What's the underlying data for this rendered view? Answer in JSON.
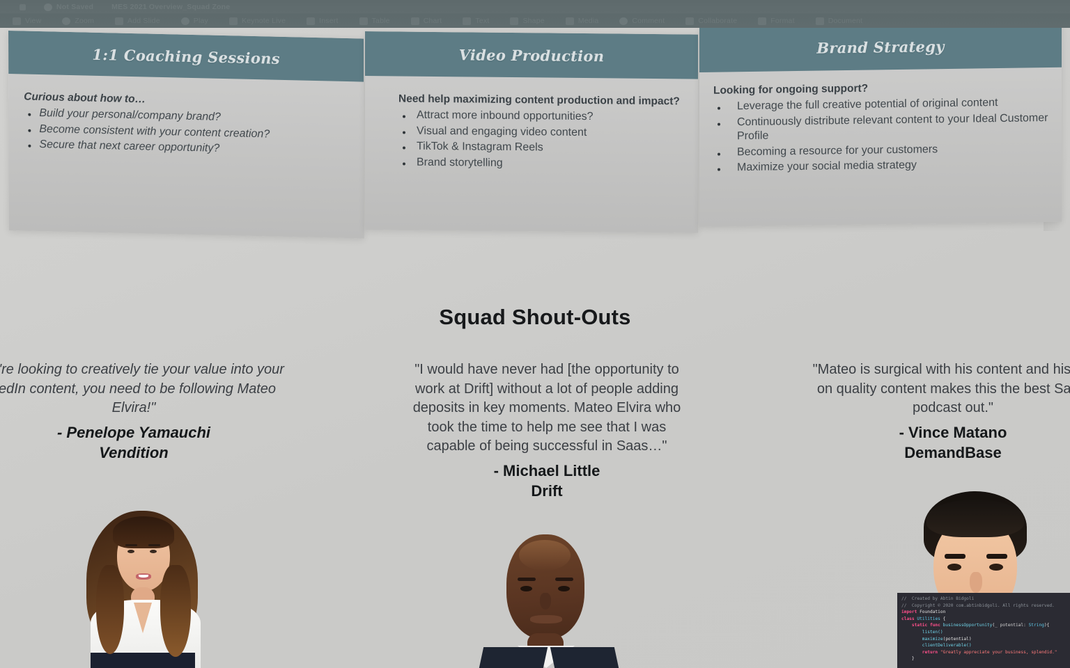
{
  "app": {
    "toolbar": {
      "row1": [
        {
          "icon": "pencil-icon",
          "label": ""
        },
        {
          "icon": "cloud-icon",
          "label": "Not Saved"
        },
        {
          "icon": "",
          "label": "MES 2021 Overview_Squad Zone"
        }
      ],
      "row2": [
        {
          "icon": "view-icon",
          "label": "View"
        },
        {
          "icon": "zoom-icon",
          "label": "Zoom"
        },
        {
          "icon": "add-slide-icon",
          "label": "Add Slide"
        },
        {
          "icon": "play-icon",
          "label": "Play"
        },
        {
          "icon": "keynote-live-icon",
          "label": "Keynote Live"
        },
        {
          "icon": "insert-icon",
          "label": "Insert"
        },
        {
          "icon": "table-icon",
          "label": "Table"
        },
        {
          "icon": "chart-icon",
          "label": "Chart"
        },
        {
          "icon": "text-icon",
          "label": "Text"
        },
        {
          "icon": "shape-icon",
          "label": "Shape"
        },
        {
          "icon": "media-icon",
          "label": "Media"
        },
        {
          "icon": "comment-icon",
          "label": "Comment"
        },
        {
          "icon": "collaborate-icon",
          "label": "Collaborate"
        },
        {
          "icon": "format-icon",
          "label": "Format"
        },
        {
          "icon": "document-icon",
          "label": "Document"
        }
      ]
    }
  },
  "cards": [
    {
      "id": "coaching",
      "title": "1:1 Coaching Sessions",
      "lead": "Curious about how to…",
      "bullets": [
        "Build your personal/company brand?",
        "Become consistent with your content creation?",
        "Secure that next career opportunity?"
      ]
    },
    {
      "id": "video",
      "title": "Video Production",
      "lead": "Need help maximizing content production and impact?",
      "bullets": [
        "Attract more inbound opportunities?",
        "Visual and engaging video content",
        "TikTok & Instagram Reels",
        "Brand storytelling"
      ]
    },
    {
      "id": "brand",
      "title": "Brand Strategy",
      "lead": "Looking for ongoing support?",
      "bullets": [
        "Leverage the full creative potential of original content",
        "Continuously distribute relevant content to your Ideal Customer Profile",
        "Becoming a resource for your customers",
        "Maximize your social media strategy"
      ]
    }
  ],
  "section": {
    "heading": "Squad Shout-Outs"
  },
  "testimonials": [
    {
      "id": "penelope",
      "quote": "ou're looking to creatively tie your value into your\nkedIn content, you need to be following Mateo\nElvira!\"",
      "author": "- Penelope Yamauchi",
      "company": "Vendition",
      "style": "italic"
    },
    {
      "id": "michael",
      "quote": "\"I would have never had [the opportunity to\nwork at Drift] without a lot of people adding\ndeposits in key moments. Mateo Elvira who\ntook the time to help me see that I was\ncapable of being successful in Saas…\"",
      "author": "- Michael Little",
      "company": "Drift",
      "style": "normal"
    },
    {
      "id": "vince",
      "quote": "\"Mateo is surgical with his content and his foc\non quality content makes this the best Sales\npodcast out.\"",
      "author": "- Vince Matano",
      "company": "DemandBase",
      "style": "normal"
    }
  ],
  "photos": [
    {
      "id": "penelope",
      "alt": "smiling woman with long brown hair, white blouse"
    },
    {
      "id": "michael",
      "alt": "smiling man in dark suit and white shirt"
    },
    {
      "id": "vince",
      "alt": "smiling young man with dark hair"
    }
  ],
  "code_overlay": {
    "lines": [
      {
        "segments": [
          {
            "cls": "c-comment",
            "t": "//  Created by Abtin Bidgoli"
          }
        ]
      },
      {
        "segments": [
          {
            "cls": "c-comment",
            "t": "//  Copyright © 2020 com.abtinbidgoli. All rights reserved."
          }
        ]
      },
      {
        "segments": [
          {
            "cls": "c-kw",
            "t": "import"
          },
          {
            "cls": "c-plain",
            "t": " Foundation"
          }
        ]
      },
      {
        "segments": [
          {
            "cls": "c-kw",
            "t": "class"
          },
          {
            "cls": "c-type",
            "t": " Utilities"
          },
          {
            "cls": "c-plain",
            "t": " {"
          }
        ]
      },
      {
        "segments": [
          {
            "cls": "c-plain",
            "t": "    "
          },
          {
            "cls": "c-kw",
            "t": "static func"
          },
          {
            "cls": "c-fn",
            "t": " businessOpportunity"
          },
          {
            "cls": "c-plain",
            "t": "("
          },
          {
            "cls": "c-param",
            "t": "_ potential: "
          },
          {
            "cls": "c-type",
            "t": "String"
          },
          {
            "cls": "c-plain",
            "t": "){"
          }
        ]
      },
      {
        "segments": [
          {
            "cls": "c-fn",
            "t": "        listen()"
          }
        ]
      },
      {
        "segments": [
          {
            "cls": "c-fn",
            "t": "        maximize"
          },
          {
            "cls": "c-plain",
            "t": "(potential)"
          }
        ]
      },
      {
        "segments": [
          {
            "cls": "c-fn",
            "t": "        clientDeliverable()"
          }
        ]
      },
      {
        "segments": [
          {
            "cls": "c-kw",
            "t": "        return"
          },
          {
            "cls": "c-str",
            "t": " \"Greatly appreciate your business, splendid.\""
          }
        ]
      },
      {
        "segments": [
          {
            "cls": "c-plain",
            "t": "    }"
          }
        ]
      }
    ]
  },
  "colors": {
    "card_header_teal": "#5d7c85",
    "slide_background": "#cccccb",
    "toolbar": "#606c6e",
    "heading_text": "#17191b",
    "code_background": "#2b2b33",
    "code_keyword": "#ff4f8b",
    "code_type": "#5ec8e8",
    "code_string": "#ff7b7b",
    "code_comment": "#8a9097"
  }
}
